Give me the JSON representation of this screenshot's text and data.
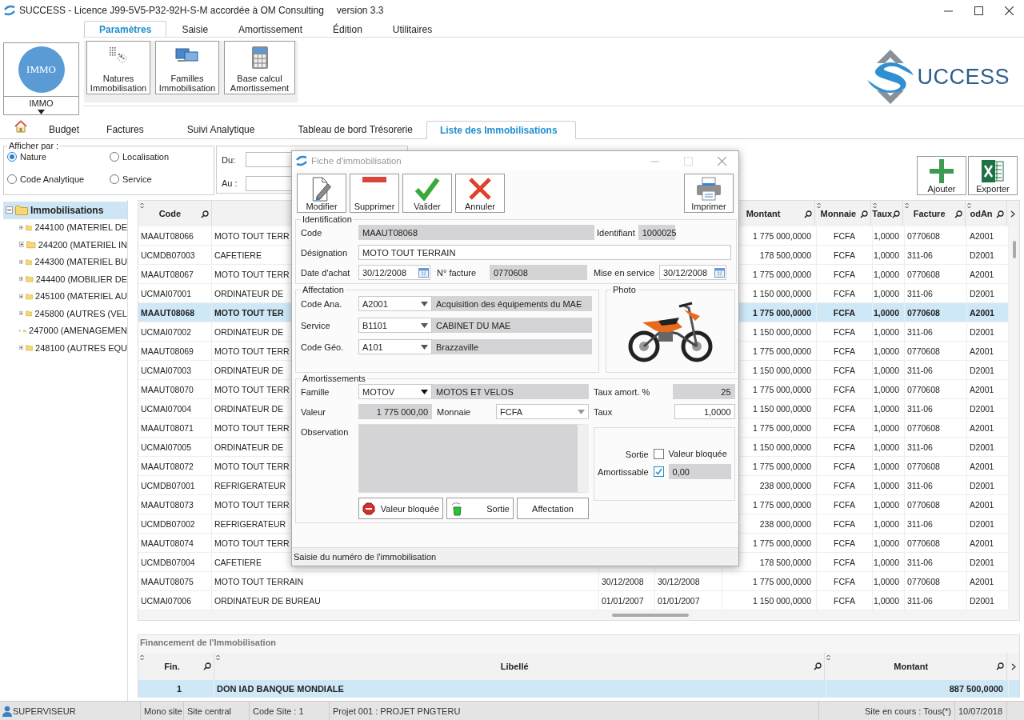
{
  "window": {
    "title": "SUCCESS - Licence J99-5V5-P32-92H-S-M accordée à OM Consulting",
    "version": "version 3.3"
  },
  "ribbon": {
    "tabs": [
      {
        "label": "Paramètres",
        "selected": true
      },
      {
        "label": "Saisie",
        "selected": false
      },
      {
        "label": "Amortissement",
        "selected": false
      },
      {
        "label": "Édition",
        "selected": false
      },
      {
        "label": "Utilitaires",
        "selected": false
      }
    ],
    "module": {
      "badge": "IMMO",
      "label": "IMMO"
    },
    "buttons": [
      {
        "kind": "natures",
        "label": "Natures Immobilisation"
      },
      {
        "kind": "familles",
        "label": "Familles Immobilisation"
      },
      {
        "kind": "calcul",
        "label": "Base calcul Amortissement"
      }
    ],
    "logo": "UCCESS"
  },
  "doc_tabs": [
    {
      "label": "Budget",
      "selected": false
    },
    {
      "label": "Factures",
      "selected": false
    },
    {
      "label": "Suivi Analytique",
      "selected": false
    },
    {
      "label": "Tableau de bord Trésorerie",
      "selected": false
    },
    {
      "label": "Liste des Immobilisations",
      "selected": true
    }
  ],
  "filter": {
    "title": "Afficher par :",
    "options": [
      {
        "label": "Nature",
        "selected": true
      },
      {
        "label": "Localisation",
        "selected": false
      },
      {
        "label": "Code Analytique",
        "selected": false
      },
      {
        "label": "Service",
        "selected": false
      }
    ],
    "from_label": "Du:",
    "to_label": "Au :"
  },
  "actions": [
    {
      "kind": "add",
      "label": "Ajouter"
    },
    {
      "kind": "excel",
      "label": "Exporter"
    }
  ],
  "tree": {
    "label": "Immobilisations",
    "expanded": true,
    "selected": true,
    "children": [
      {
        "label": "244100 (MATERIEL DE",
        "expanded": false,
        "selected": false
      },
      {
        "label": "244200 (MATERIEL IN",
        "expanded": false,
        "selected": false
      },
      {
        "label": "244300 (MATERIEL BU",
        "expanded": false,
        "selected": false
      },
      {
        "label": "244400 (MOBILIER DE",
        "expanded": false,
        "selected": false
      },
      {
        "label": "245100 (MATERIEL AU",
        "expanded": false,
        "selected": false
      },
      {
        "label": "245800 (AUTRES (VEL",
        "expanded": false,
        "selected": false
      },
      {
        "label": "247000 (AMENAGEMEN",
        "expanded": false,
        "selected": false
      },
      {
        "label": "248100 (AUTRES EQU",
        "expanded": false,
        "selected": false
      }
    ]
  },
  "grid": {
    "columns": [
      "Code",
      null,
      null,
      null,
      "Montant",
      "Monnaie",
      "Taux",
      "Facture",
      "odAn"
    ],
    "rows": [
      {
        "selected": false,
        "cells": [
          "MAAUT08066",
          "MOTO TOUT TERR",
          null,
          null,
          "1 775 000,0000",
          "FCFA",
          "1,0000",
          "0770608",
          "A2001"
        ]
      },
      {
        "selected": false,
        "cells": [
          "UCMDB07003",
          "CAFETIERE",
          null,
          null,
          "178 500,0000",
          "FCFA",
          "1,0000",
          "311-06",
          "D2001"
        ]
      },
      {
        "selected": false,
        "cells": [
          "MAAUT08067",
          "MOTO TOUT TERR",
          null,
          null,
          "1 775 000,0000",
          "FCFA",
          "1,0000",
          "0770608",
          "A2001"
        ]
      },
      {
        "selected": false,
        "cells": [
          "UCMAI07001",
          "ORDINATEUR DE",
          null,
          null,
          "1 150 000,0000",
          "FCFA",
          "1,0000",
          "311-06",
          "D2001"
        ]
      },
      {
        "selected": true,
        "cells": [
          "MAAUT08068",
          "MOTO TOUT TER",
          null,
          null,
          "1 775 000,0000",
          "FCFA",
          "1,0000",
          "0770608",
          "A2001"
        ]
      },
      {
        "selected": false,
        "cells": [
          "UCMAI07002",
          "ORDINATEUR DE",
          null,
          null,
          "1 150 000,0000",
          "FCFA",
          "1,0000",
          "311-06",
          "D2001"
        ]
      },
      {
        "selected": false,
        "cells": [
          "MAAUT08069",
          "MOTO TOUT TERR",
          null,
          null,
          "1 775 000,0000",
          "FCFA",
          "1,0000",
          "0770608",
          "A2001"
        ]
      },
      {
        "selected": false,
        "cells": [
          "UCMAI07003",
          "ORDINATEUR DE",
          null,
          null,
          "1 150 000,0000",
          "FCFA",
          "1,0000",
          "311-06",
          "D2001"
        ]
      },
      {
        "selected": false,
        "cells": [
          "MAAUT08070",
          "MOTO TOUT TERR",
          null,
          null,
          "1 775 000,0000",
          "FCFA",
          "1,0000",
          "0770608",
          "A2001"
        ]
      },
      {
        "selected": false,
        "cells": [
          "UCMAI07004",
          "ORDINATEUR DE",
          null,
          null,
          "1 150 000,0000",
          "FCFA",
          "1,0000",
          "311-06",
          "D2001"
        ]
      },
      {
        "selected": false,
        "cells": [
          "MAAUT08071",
          "MOTO TOUT TERR",
          null,
          null,
          "1 775 000,0000",
          "FCFA",
          "1,0000",
          "0770608",
          "A2001"
        ]
      },
      {
        "selected": false,
        "cells": [
          "UCMAI07005",
          "ORDINATEUR DE",
          null,
          null,
          "1 150 000,0000",
          "FCFA",
          "1,0000",
          "311-06",
          "D2001"
        ]
      },
      {
        "selected": false,
        "cells": [
          "MAAUT08072",
          "MOTO TOUT TERR",
          null,
          null,
          "1 775 000,0000",
          "FCFA",
          "1,0000",
          "0770608",
          "A2001"
        ]
      },
      {
        "selected": false,
        "cells": [
          "UCMDB07001",
          "REFRIGERATEUR",
          null,
          null,
          "238 000,0000",
          "FCFA",
          "1,0000",
          "311-06",
          "D2001"
        ]
      },
      {
        "selected": false,
        "cells": [
          "MAAUT08073",
          "MOTO TOUT TERR",
          null,
          null,
          "1 775 000,0000",
          "FCFA",
          "1,0000",
          "0770608",
          "A2001"
        ]
      },
      {
        "selected": false,
        "cells": [
          "UCMDB07002",
          "REFRIGERATEUR",
          null,
          null,
          "238 000,0000",
          "FCFA",
          "1,0000",
          "311-06",
          "D2001"
        ]
      },
      {
        "selected": false,
        "cells": [
          "MAAUT08074",
          "MOTO TOUT TERR",
          null,
          null,
          "1 775 000,0000",
          "FCFA",
          "1,0000",
          "0770608",
          "A2001"
        ]
      },
      {
        "selected": false,
        "cells": [
          "UCMDB07004",
          "CAFETIERE",
          null,
          null,
          "178 500,0000",
          "FCFA",
          "1,0000",
          "311-06",
          "D2001"
        ]
      },
      {
        "selected": false,
        "cells": [
          "MAAUT08075",
          "MOTO TOUT TERRAIN",
          "30/12/2008",
          "30/12/2008",
          "1 775 000,0000",
          "FCFA",
          "1,0000",
          "0770608",
          "A2001"
        ]
      },
      {
        "selected": false,
        "cells": [
          "UCMAI07006",
          "ORDINATEUR DE BUREAU",
          "01/01/2007",
          "01/01/2007",
          "1 150 000,0000",
          "FCFA",
          "1,0000",
          "311-06",
          "D2001"
        ]
      }
    ]
  },
  "funding": {
    "title": "Financement de l'Immobilisation",
    "columns": [
      "Fin.",
      "Libellé",
      "Montant"
    ],
    "rows": [
      {
        "selected": true,
        "cells": [
          "1",
          "DON IAD BANQUE MONDIALE",
          "887 500,0000"
        ]
      }
    ]
  },
  "status_bar": {
    "user": "SUPERVISEUR",
    "items": [
      "Mono site",
      "Site central",
      "Code Site : 1",
      "Projet 001 : PROJET PNGTERU",
      "Site en cours : Tous(*)",
      "10/07/2018"
    ]
  },
  "dialog": {
    "title": "Fiche d'immobilisation",
    "toolbar": [
      {
        "kind": "edit",
        "label": "Modifier"
      },
      {
        "kind": "delete",
        "label": "Supprimer"
      },
      {
        "kind": "validate",
        "label": "Valider"
      },
      {
        "kind": "cancel",
        "label": "Annuler"
      },
      {
        "kind": "print",
        "label": "Imprimer"
      }
    ],
    "identification": {
      "title": "Identification",
      "code": {
        "label": "Code",
        "value": "MAAUT08068",
        "readonly": true
      },
      "identifiant": {
        "label": "Identifiant",
        "value": "1000025",
        "readonly": true
      },
      "designation": {
        "label": "Désignation",
        "value": "MOTO TOUT TERRAIN",
        "readonly": false
      },
      "date_achat": {
        "label": "Date d'achat",
        "value": "30/12/2008",
        "readonly": false
      },
      "facture": {
        "label": "N° facture",
        "value": "0770608",
        "readonly": true
      },
      "mise_en_service": {
        "label": "Mise en service",
        "value": "30/12/2008",
        "readonly": false
      }
    },
    "affectation": {
      "title": "Affectation",
      "rows": [
        {
          "label": "Code Ana.",
          "code": "A2001",
          "description": "Acquisition des équipements du MAE"
        },
        {
          "label": "Service",
          "code": "B1101",
          "description": "CABINET DU MAE"
        },
        {
          "label": "Code Géo.",
          "code": "A101",
          "description": "Brazzaville"
        }
      ]
    },
    "photo": {
      "title": "Photo"
    },
    "amortissements": {
      "title": "Amortissements",
      "famille": {
        "label": "Famille",
        "code": "MOTOV",
        "description": "MOTOS ET VELOS"
      },
      "taux_amort": {
        "label": "Taux amort. %",
        "value": "25",
        "readonly": true
      },
      "valeur": {
        "label": "Valeur",
        "value": "1 775 000,00",
        "readonly": true
      },
      "monnaie": {
        "label": "Monnaie",
        "value": "FCFA"
      },
      "taux": {
        "label": "Taux",
        "value": "1,0000",
        "readonly": false
      },
      "observation": {
        "label": "Observation",
        "readonly": true
      },
      "sortie": {
        "label": "Sortie",
        "checked": false
      },
      "valeur_bloquee": {
        "label": "Valeur bloquée",
        "value": "0,00",
        "readonly": true
      },
      "amortissable": {
        "label": "Amortissable",
        "checked": true
      },
      "buttons": [
        {
          "kind": "blocked",
          "label": "Valeur bloquée"
        },
        {
          "kind": "exit",
          "label": "Sortie"
        },
        {
          "kind": "assign",
          "label": "Affectation"
        }
      ]
    },
    "status": "Saisie du numéro de l'immobilisation"
  }
}
